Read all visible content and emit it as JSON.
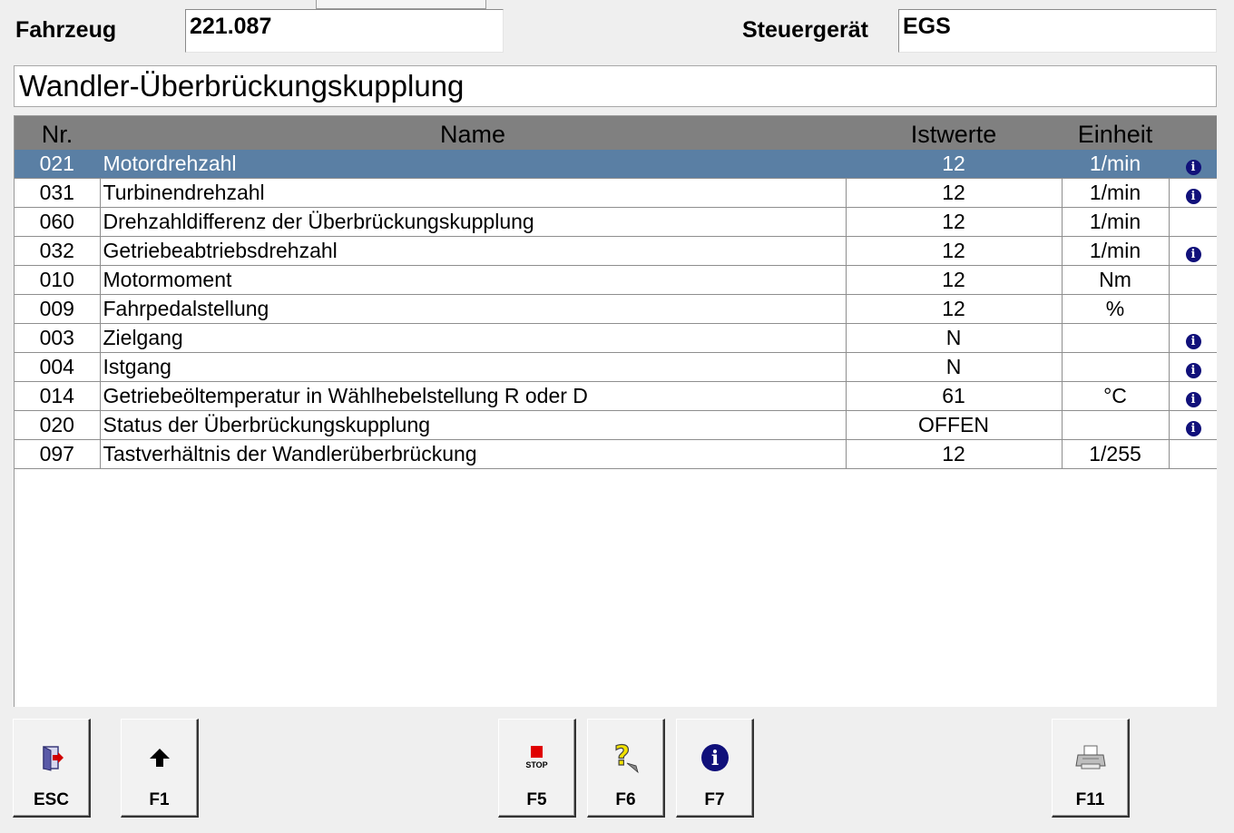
{
  "header": {
    "vehicle_label": "Fahrzeug",
    "vehicle_value": "221.087",
    "ecu_label": "Steuergerät",
    "ecu_value": "EGS"
  },
  "title": "Wandler-Überbrückungskupplung",
  "table": {
    "columns": [
      "Nr.",
      "Name",
      "Istwerte",
      "Einheit"
    ],
    "rows": [
      {
        "nr": "021",
        "name": "Motordrehzahl",
        "value": "12",
        "unit": "1/min",
        "info": true
      },
      {
        "nr": "031",
        "name": "Turbinendrehzahl",
        "value": "12",
        "unit": "1/min",
        "info": true
      },
      {
        "nr": "060",
        "name": "Drehzahldifferenz der Überbrückungskupplung",
        "value": "12",
        "unit": "1/min",
        "info": false
      },
      {
        "nr": "032",
        "name": "Getriebeabtriebsdrehzahl",
        "value": "12",
        "unit": "1/min",
        "info": true
      },
      {
        "nr": "010",
        "name": "Motormoment",
        "value": "12",
        "unit": "Nm",
        "info": false
      },
      {
        "nr": "009",
        "name": "Fahrpedalstellung",
        "value": "12",
        "unit": "%",
        "info": false
      },
      {
        "nr": "003",
        "name": "Zielgang",
        "value": "N",
        "unit": "",
        "info": true
      },
      {
        "nr": "004",
        "name": "Istgang",
        "value": "N",
        "unit": "",
        "info": true
      },
      {
        "nr": "014",
        "name": "Getriebeöltemperatur in Wählhebelstellung R oder D",
        "value": "61",
        "unit": "°C",
        "info": true
      },
      {
        "nr": "020",
        "name": "Status der Überbrückungskupplung",
        "value": "OFFEN",
        "unit": "",
        "info": true
      },
      {
        "nr": "097",
        "name": "Tastverhältnis der Wandlerüberbrückung",
        "value": "12",
        "unit": "1/255",
        "info": false
      }
    ],
    "selected_row": 0
  },
  "function_keys": [
    {
      "key": "ESC",
      "icon": "exit-door-icon"
    },
    {
      "key": "F1",
      "icon": "arrow-up-icon"
    },
    {
      "key": "F5",
      "icon": "stop-icon",
      "icon_text": "STOP"
    },
    {
      "key": "F6",
      "icon": "help-question-icon"
    },
    {
      "key": "F7",
      "icon": "info-icon"
    },
    {
      "key": "F11",
      "icon": "printer-icon"
    }
  ],
  "colors": {
    "selected_row": "#5a7fa4",
    "header_row": "#808080",
    "info_icon": "#10107a",
    "stop": "#e00000"
  }
}
